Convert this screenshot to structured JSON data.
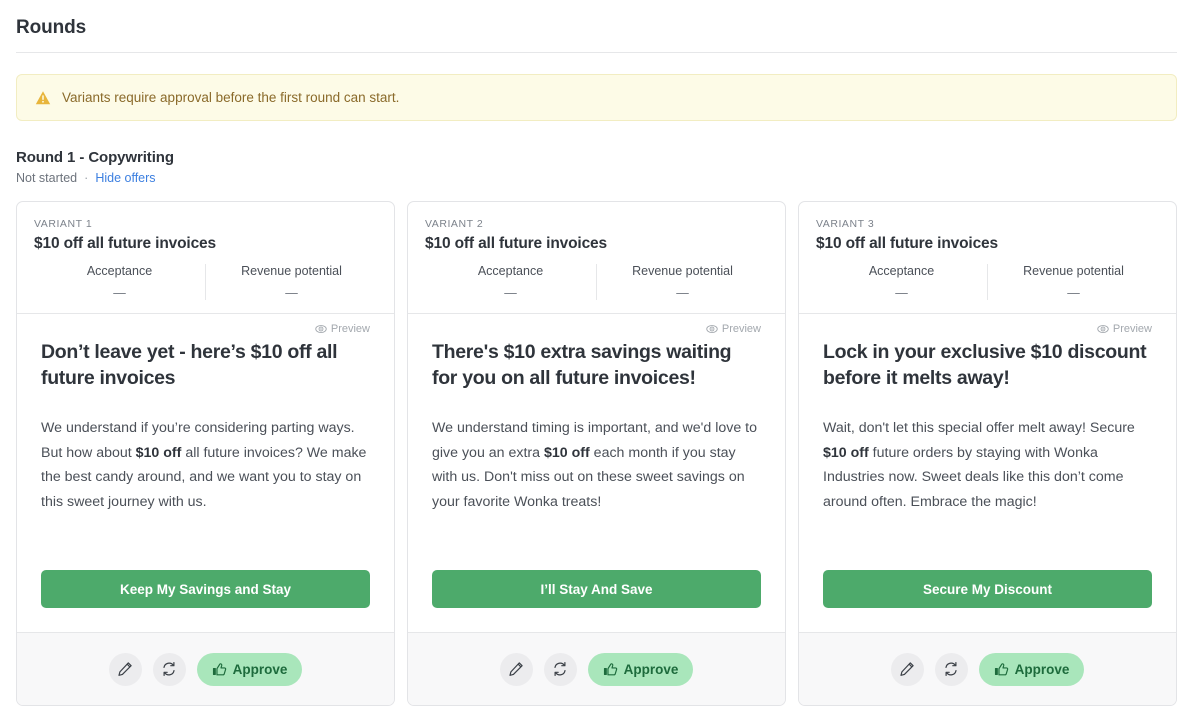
{
  "page": {
    "title": "Rounds"
  },
  "banner": {
    "icon": "warning-triangle-icon",
    "text": "Variants require approval before the first round can start."
  },
  "round": {
    "title": "Round 1 - Copywriting",
    "status": "Not started",
    "separator": "·",
    "toggle_link": "Hide offers"
  },
  "metric_labels": {
    "acceptance": "Acceptance",
    "revenue_potential": "Revenue potential"
  },
  "preview_label": "Preview",
  "actions": {
    "edit_icon": "pencil-icon",
    "regenerate_icon": "refresh-icon",
    "approve_label": "Approve",
    "approve_icon": "thumbs-up-icon"
  },
  "colors": {
    "cta_green": "#4daa6b",
    "approve_bg": "#a9e6bb",
    "approve_text": "#1d6b3c",
    "banner_bg": "#fdfbe7",
    "banner_border": "#f2edc2",
    "banner_text": "#8a6a2a",
    "link_blue": "#3c7fe0",
    "footer_bg": "#f8f8f9",
    "card_border": "#e3e4e7"
  },
  "variants": [
    {
      "label": "VARIANT 1",
      "offer_title": "$10 off all future invoices",
      "acceptance": "—",
      "revenue_potential": "—",
      "headline": "Don’t leave yet - here’s $10 off all future invoices",
      "body_part1": "We understand if you’re considering parting ways. But how about ",
      "body_bold": "$10 off",
      "body_part2": " all future invoices? We make the best candy around, and we want you to stay on this sweet journey with us.",
      "cta": "Keep My Savings and Stay"
    },
    {
      "label": "VARIANT 2",
      "offer_title": "$10 off all future invoices",
      "acceptance": "—",
      "revenue_potential": "—",
      "headline": "There's $10 extra savings waiting for you on all future invoices!",
      "body_part1": "We understand timing is important, and we'd love to give you an extra ",
      "body_bold": "$10 off",
      "body_part2": " each month if you stay with us. Don't miss out on these sweet savings on your favorite Wonka treats!",
      "cta": "I’ll Stay And Save"
    },
    {
      "label": "VARIANT 3",
      "offer_title": "$10 off all future invoices",
      "acceptance": "—",
      "revenue_potential": "—",
      "headline": "Lock in your exclusive $10 discount before it melts away!",
      "body_part1": "Wait, don't let this special offer melt away! Secure ",
      "body_bold": "$10 off",
      "body_part2": " future orders by staying with Wonka Industries now. Sweet deals like this don’t come around often. Embrace the magic!",
      "cta": "Secure My Discount"
    }
  ]
}
